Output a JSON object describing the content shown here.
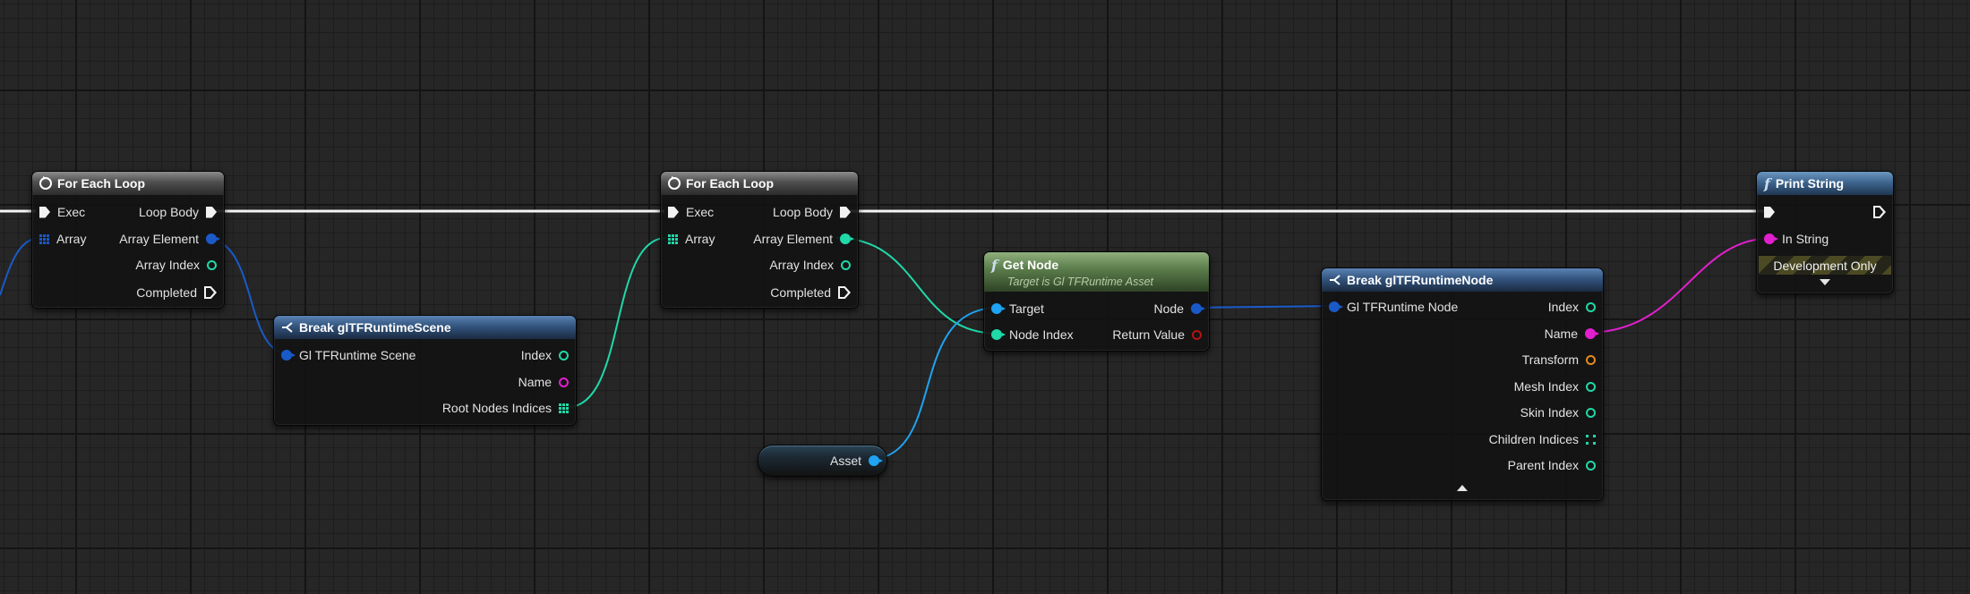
{
  "colors": {
    "exec": "#ffffff",
    "struct": "#1a5ac8",
    "integer": "#20d8a8",
    "name": "#e21fcf",
    "transform": "#e58a1e",
    "object": "#1fa3f2",
    "return_value": "#b21414"
  },
  "nodes": {
    "loop1": {
      "title": "For Each Loop",
      "pins": {
        "exec": "Exec",
        "array": "Array",
        "loop_body": "Loop Body",
        "array_element": "Array Element",
        "array_index": "Array Index",
        "completed": "Completed"
      }
    },
    "break_scene": {
      "title": "Break glTFRuntimeScene",
      "pins": {
        "scene": "Gl TFRuntime Scene",
        "index": "Index",
        "name": "Name",
        "root_nodes": "Root Nodes Indices"
      }
    },
    "loop2": {
      "title": "For Each Loop",
      "pins": {
        "exec": "Exec",
        "array": "Array",
        "loop_body": "Loop Body",
        "array_element": "Array Element",
        "array_index": "Array Index",
        "completed": "Completed"
      }
    },
    "get_node": {
      "title": "Get Node",
      "subtitle": "Target is Gl TFRuntime Asset",
      "pins": {
        "target": "Target",
        "node_index": "Node Index",
        "node": "Node",
        "return_value": "Return Value"
      }
    },
    "asset_var": {
      "label": "Asset"
    },
    "break_node": {
      "title": "Break glTFRuntimeNode",
      "pins": {
        "runtime_node": "Gl TFRuntime Node",
        "index": "Index",
        "name": "Name",
        "transform": "Transform",
        "mesh_index": "Mesh Index",
        "skin_index": "Skin Index",
        "children_indices": "Children Indices",
        "parent_index": "Parent Index"
      }
    },
    "print_string": {
      "title": "Print String",
      "pins": {
        "in_string": "In String"
      },
      "banner": "Development Only"
    }
  }
}
